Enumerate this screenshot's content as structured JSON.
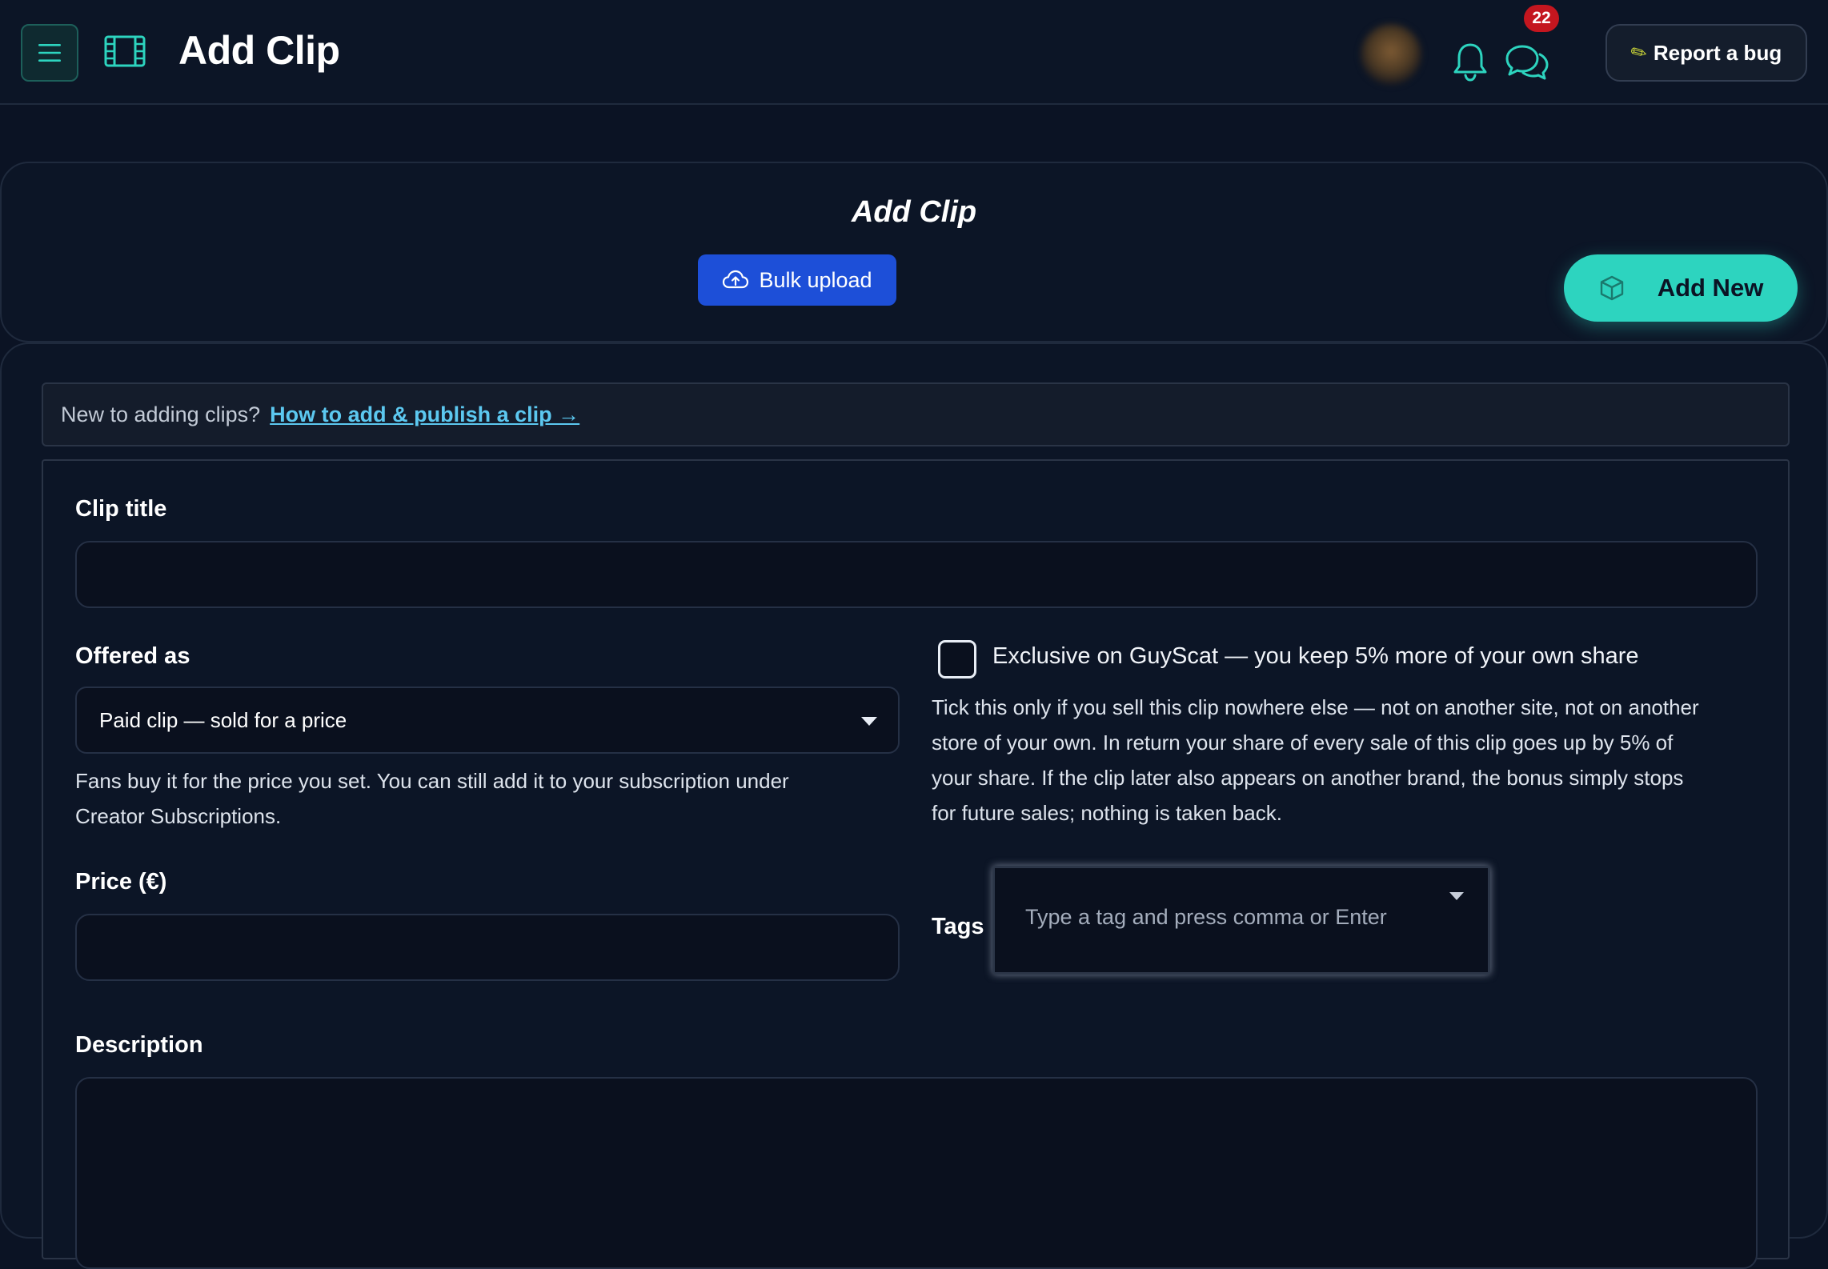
{
  "topbar": {
    "app_title": "Add Clip",
    "notification_count": "22",
    "report_bug_label": "Report a bug",
    "accent_color": "#2dd4bf"
  },
  "header": {
    "title": "Add Clip",
    "bulk_upload_label": "Bulk upload",
    "add_new_label": "Add New"
  },
  "help_banner": {
    "prefix": "New to adding clips?",
    "link_text": "How to add & publish a clip →"
  },
  "form": {
    "clip_title_label": "Clip title",
    "clip_title_value": "",
    "offered_as_label": "Offered as",
    "offered_as_value": "Paid clip — sold for a price",
    "offered_as_help_line1": "Fans buy it for the price you set. You can still add it to your subscription under",
    "offered_as_help_line2": "Creator Subscriptions.",
    "exclusive_label": "Exclusive on GuyScat — you keep 5% more of your own share",
    "exclusive_checked": false,
    "exclusive_help_line1": "Tick this only if you sell this clip nowhere else — not on another site, not on another",
    "exclusive_help_line2": "store of your own. In return your share of every sale of this clip goes up by 5% of",
    "exclusive_help_line3": "your share. If the clip later also appears on another brand, the bonus simply stops",
    "exclusive_help_line4": "for future sales; nothing is taken back.",
    "price_label": "Price (€)",
    "price_value": "",
    "tags_label": "Tags",
    "tags_placeholder": "Type a tag and press comma or Enter",
    "description_label": "Description",
    "description_value": ""
  }
}
